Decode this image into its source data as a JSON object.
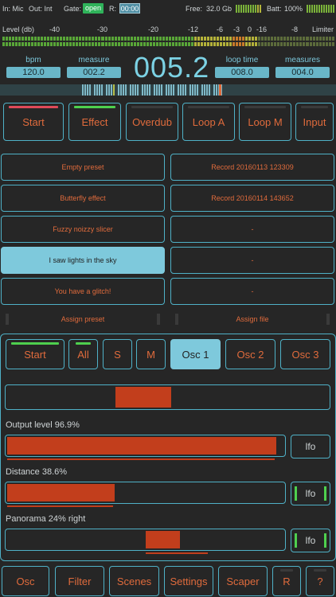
{
  "status": {
    "input": "In: Mic",
    "output": "Out: Int",
    "gate_label": "Gate:",
    "gate_value": "open",
    "rec_label": "R:",
    "rec_value": "00:00",
    "free_label": "Free:",
    "free_value": "32.0 Gb",
    "batt_label": "Batt:",
    "batt_value": "100%"
  },
  "level": {
    "label": "Level (db)",
    "scale": [
      "-40",
      "-30",
      "-20",
      "-12",
      "-6",
      "-3",
      "0",
      "-16",
      "-8"
    ],
    "limiter": "Limiter"
  },
  "info": {
    "bpm_label": "bpm",
    "bpm_value": "120.0",
    "measure_label": "measure",
    "measure_value": "002.2",
    "position_value": "005.2",
    "loop_time_label": "loop time",
    "loop_time_value": "008.0",
    "measures_label": "measures",
    "measures_value": "004.0"
  },
  "modes": {
    "start": "Start",
    "effect": "Effect",
    "overdub": "Overdub",
    "loop_a": "Loop A",
    "loop_m": "Loop M",
    "input": "Input"
  },
  "presets": {
    "left": [
      "Empty preset",
      "Butterfly effect",
      "Fuzzy noizzy slicer",
      "I saw lights in the sky",
      "You have a glitch!"
    ],
    "right": [
      "Record 20160113 123309",
      "Record 20160114 143652",
      "-",
      "-",
      "-"
    ],
    "assign_preset": "Assign preset",
    "assign_file": "Assign file"
  },
  "panel": {
    "tabs": {
      "start": "Start",
      "all": "All",
      "s": "S",
      "m": "M",
      "osc1": "Osc 1",
      "osc2": "Osc 2",
      "osc3": "Osc 3"
    },
    "output_label": "Output level 96.9%",
    "output_level": 0.969,
    "distance_label": "Distance 38.6%",
    "distance_level": 0.386,
    "panorama_label": "Panorama 24% right",
    "panorama_level": 0.24,
    "lfo": "lfo"
  },
  "bottom": {
    "osc": "Osc",
    "filter": "Filter",
    "scenes": "Scenes",
    "settings": "Settings",
    "scaper": "Scaper",
    "r": "R",
    "help": "?"
  },
  "colors": {
    "accent": "#4fb1c7",
    "selected": "#7ec9dc",
    "label_text": "#e06b3c",
    "fill": "#c23e1c",
    "led_green": "#4ed04e",
    "led_red": "#e04a5a"
  }
}
